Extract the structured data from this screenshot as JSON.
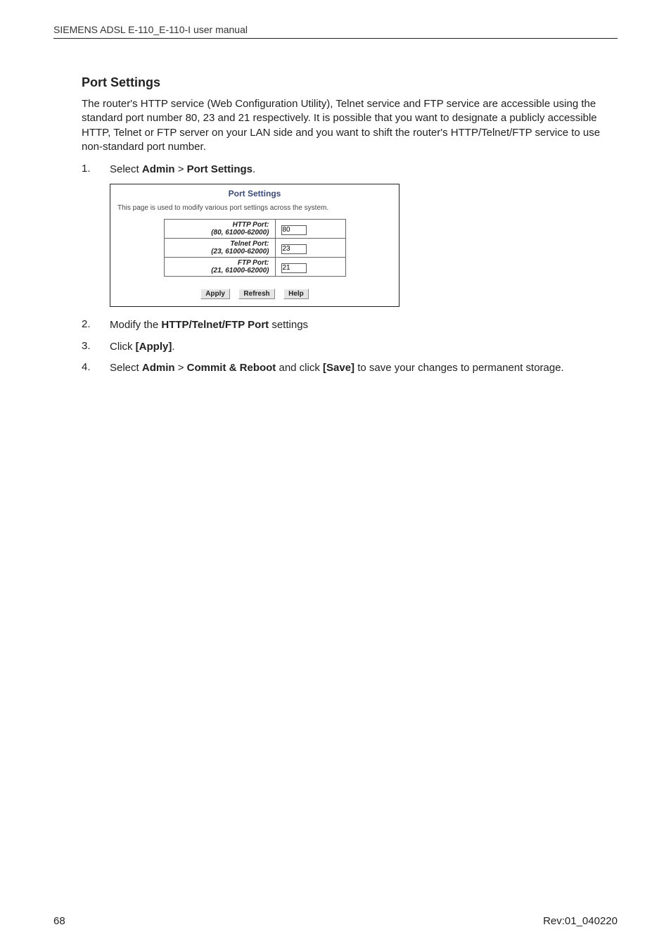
{
  "header": {
    "running_head": "SIEMENS ADSL E-110_E-110-I user manual"
  },
  "section": {
    "title": "Port Settings",
    "intro": "The router's HTTP service (Web Configuration Utility), Telnet service and FTP service are accessible using the standard port number 80, 23 and 21 respectively. It is possible that you want to designate a publicly accessible HTTP, Telnet or FTP server on your LAN side and you want to shift the router's HTTP/Telnet/FTP service to use non-standard port number."
  },
  "steps": [
    {
      "num": "1.",
      "pre": "Select ",
      "b1": "Admin",
      "mid": " > ",
      "b2": "Port Settings",
      "post": "."
    },
    {
      "num": "2.",
      "pre": "Modify the ",
      "b1": "HTTP/Telnet/FTP Port",
      "post": " settings"
    },
    {
      "num": "3.",
      "pre": "Click ",
      "b1": "[Apply]",
      "post": "."
    },
    {
      "num": "4.",
      "pre": "Select ",
      "b1": "Admin",
      "mid": " > ",
      "b2": "Commit & Reboot",
      "mid2": " and click ",
      "b3": "[Save]",
      "post": " to save your changes to permanent storage."
    }
  ],
  "embed": {
    "title": "Port Settings",
    "desc": "This page is used to modify various port settings across the system.",
    "rows": [
      {
        "name": "HTTP Port:",
        "range": "(80, 61000-62000)",
        "value": "80"
      },
      {
        "name": "Telnet Port:",
        "range": "(23, 61000-62000)",
        "value": "23"
      },
      {
        "name": "FTP Port:",
        "range": "(21, 61000-62000)",
        "value": "21"
      }
    ],
    "buttons": {
      "apply": "Apply",
      "refresh": "Refresh",
      "help": "Help"
    }
  },
  "footer": {
    "page": "68",
    "rev": "Rev:01_040220"
  }
}
